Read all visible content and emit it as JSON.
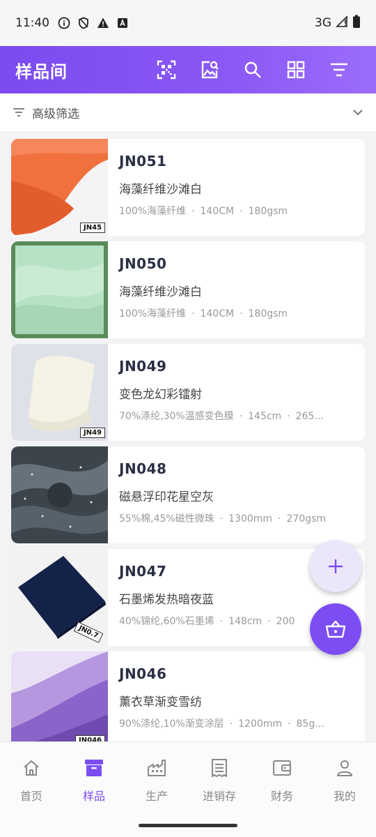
{
  "status_bar": {
    "time": "11:40",
    "network": "3G"
  },
  "app_bar": {
    "title": "样品间"
  },
  "filter": {
    "label": "高级筛选"
  },
  "samples": [
    {
      "code": "JN051",
      "name": "海藻纤维沙滩白",
      "composition": "100%海藻纤维",
      "width": "140CM",
      "weight": "180gsm",
      "tag": "JN45"
    },
    {
      "code": "JN050",
      "name": "海藻纤维沙滩白",
      "composition": "100%海藻纤维",
      "width": "140CM",
      "weight": "180gsm",
      "tag": ""
    },
    {
      "code": "JN049",
      "name": "变色龙幻彩镭射",
      "composition": "70%涤纶,30%温感变色膜",
      "width": "145cm",
      "weight": "265...",
      "tag": "JN49"
    },
    {
      "code": "JN048",
      "name": "磁悬浮印花星空灰",
      "composition": "55%棉,45%磁性微珠",
      "width": "1300mm",
      "weight": "270gsm",
      "tag": ""
    },
    {
      "code": "JN047",
      "name": "石墨烯发热暗夜蓝",
      "composition": "40%锦纶,60%石墨烯",
      "width": "148cm",
      "weight": "200",
      "tag": "JN0.7"
    },
    {
      "code": "JN046",
      "name": "薰衣草渐变雪纺",
      "composition": "90%涤纶,10%渐变涂层",
      "width": "1200mm",
      "weight": "85g...",
      "tag": "JN046"
    }
  ],
  "bottom_nav": [
    {
      "label": "首页",
      "icon": "home-icon"
    },
    {
      "label": "样品",
      "icon": "archive-box-icon"
    },
    {
      "label": "生产",
      "icon": "factory-icon"
    },
    {
      "label": "进销存",
      "icon": "receipt-icon"
    },
    {
      "label": "财务",
      "icon": "wallet-icon"
    },
    {
      "label": "我的",
      "icon": "person-icon"
    }
  ],
  "colors": {
    "accent": "#7c4df2",
    "app_bar_start": "#7b4bf0",
    "app_bar_end": "#9b6dfa"
  }
}
